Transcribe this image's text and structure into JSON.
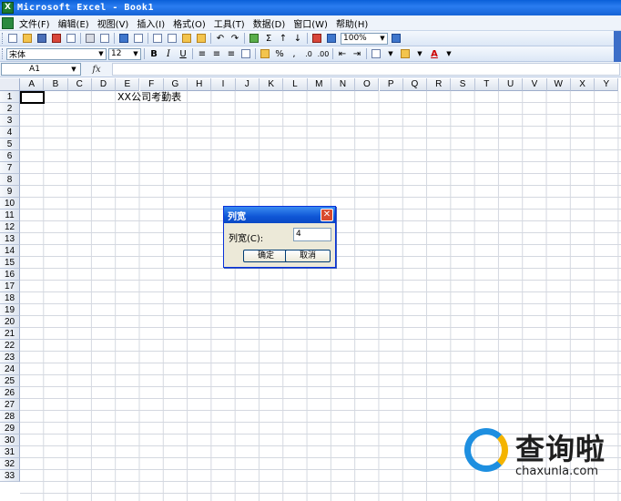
{
  "window": {
    "title": "Microsoft Excel - Book1",
    "app_icon_label": "X"
  },
  "menu": {
    "items": [
      "文件(F)",
      "编辑(E)",
      "视图(V)",
      "插入(I)",
      "格式(O)",
      "工具(T)",
      "数据(D)",
      "窗口(W)",
      "帮助(H)"
    ]
  },
  "toolbar": {
    "zoom": "100%",
    "sum_glyph": "Σ"
  },
  "format_toolbar": {
    "font_name": "宋体",
    "font_size": "12",
    "bold": "B",
    "italic": "I",
    "underline": "U",
    "percent": "%",
    "comma": ",",
    "font_color_glyph": "A"
  },
  "formula_bar": {
    "name_box": "A1",
    "fx_label": "fx",
    "content": ""
  },
  "sheet": {
    "columns": [
      "A",
      "B",
      "C",
      "D",
      "E",
      "F",
      "G",
      "H",
      "I",
      "J",
      "K",
      "L",
      "M",
      "N",
      "O",
      "P",
      "Q",
      "R",
      "S",
      "T",
      "U",
      "V",
      "W",
      "X",
      "Y"
    ],
    "rows": [
      "1",
      "2",
      "3",
      "4",
      "5",
      "6",
      "7",
      "8",
      "9",
      "10",
      "11",
      "12",
      "13",
      "14",
      "15",
      "16",
      "17",
      "18",
      "19",
      "20",
      "21",
      "22",
      "23",
      "24",
      "25",
      "26",
      "27",
      "28",
      "29",
      "30",
      "31",
      "32",
      "33"
    ],
    "cell_text": "XX公司考勤表"
  },
  "dialog": {
    "title": "列宽",
    "label": "列宽(C):",
    "value": "4",
    "ok": "确定",
    "cancel": "取消",
    "close_glyph": "✕"
  },
  "watermark": {
    "title": "查询啦",
    "url": "chaxunla.com"
  }
}
